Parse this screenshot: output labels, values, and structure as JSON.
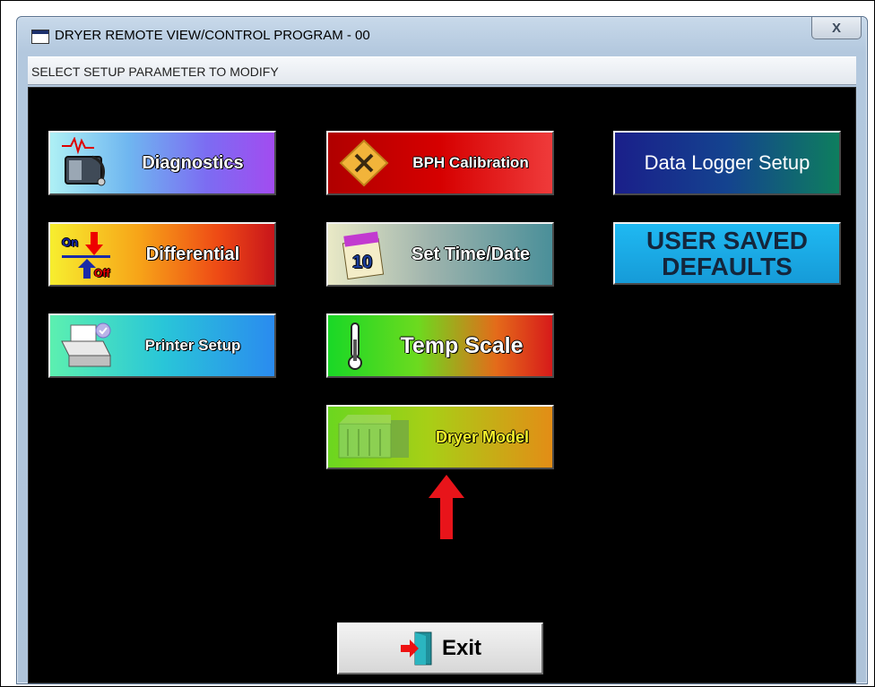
{
  "window": {
    "title": "DRYER REMOTE VIEW/CONTROL PROGRAM - 00",
    "close_label": "X"
  },
  "subheader": "SELECT SETUP PARAMETER TO MODIFY",
  "buttons": {
    "diagnostics": "Diagnostics",
    "differential": "Differential",
    "printer_setup": "Printer Setup",
    "bph_calibration": "BPH Calibration",
    "set_time_date": "Set Time/Date",
    "temp_scale": "Temp Scale",
    "dryer_model": "Dryer Model",
    "data_logger_setup": "Data Logger Setup",
    "user_saved_defaults_line1": "USER SAVED",
    "user_saved_defaults_line2": "DEFAULTS",
    "exit": "Exit"
  },
  "icons": {
    "diagnostics": "monitor-stethoscope-icon",
    "differential": "on-off-arrows-icon",
    "printer_setup": "printer-icon",
    "bph_calibration": "tools-diamond-icon",
    "set_time_date": "calendar-icon",
    "temp_scale": "thermometer-icon",
    "dryer_model": "dryer-machine-icon",
    "exit": "exit-door-icon",
    "annotation": "red-up-arrow"
  },
  "calendar_day": "10",
  "differential_icon_text": {
    "on": "On",
    "off": "Off"
  }
}
